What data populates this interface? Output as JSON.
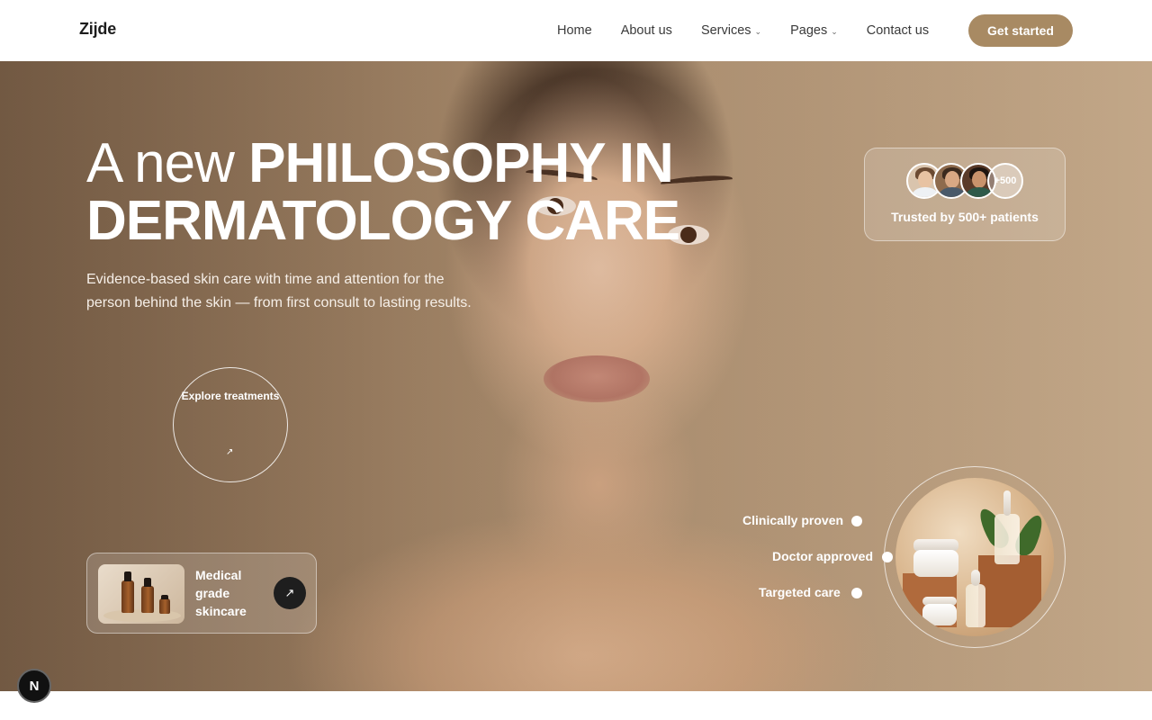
{
  "brand": {
    "name": "Zijde",
    "accent": "#a88a63"
  },
  "nav": {
    "items": [
      {
        "label": "Home",
        "dropdown": false
      },
      {
        "label": "About us",
        "dropdown": false
      },
      {
        "label": "Services",
        "dropdown": true
      },
      {
        "label": "Pages",
        "dropdown": true
      },
      {
        "label": "Contact us",
        "dropdown": false
      }
    ],
    "cta_label": "Get started"
  },
  "hero": {
    "headline_light": "A new ",
    "headline_bold": "PHILOSOPHY IN DERMATOLOGY CARE",
    "subtext": "Evidence-based skin care with time and attention for the person behind the skin — from first consult to lasting results.",
    "explore_label": "Explore treatments",
    "explore_arrow": "↗"
  },
  "trust": {
    "more_count": "+500",
    "text": "Trusted by 500+ patients"
  },
  "product_card": {
    "title": "Medical grade skincare",
    "arrow": "↗"
  },
  "features": [
    "Clinically proven",
    "Doctor approved",
    "Targeted care"
  ],
  "dev_badge": {
    "letter": "N"
  }
}
